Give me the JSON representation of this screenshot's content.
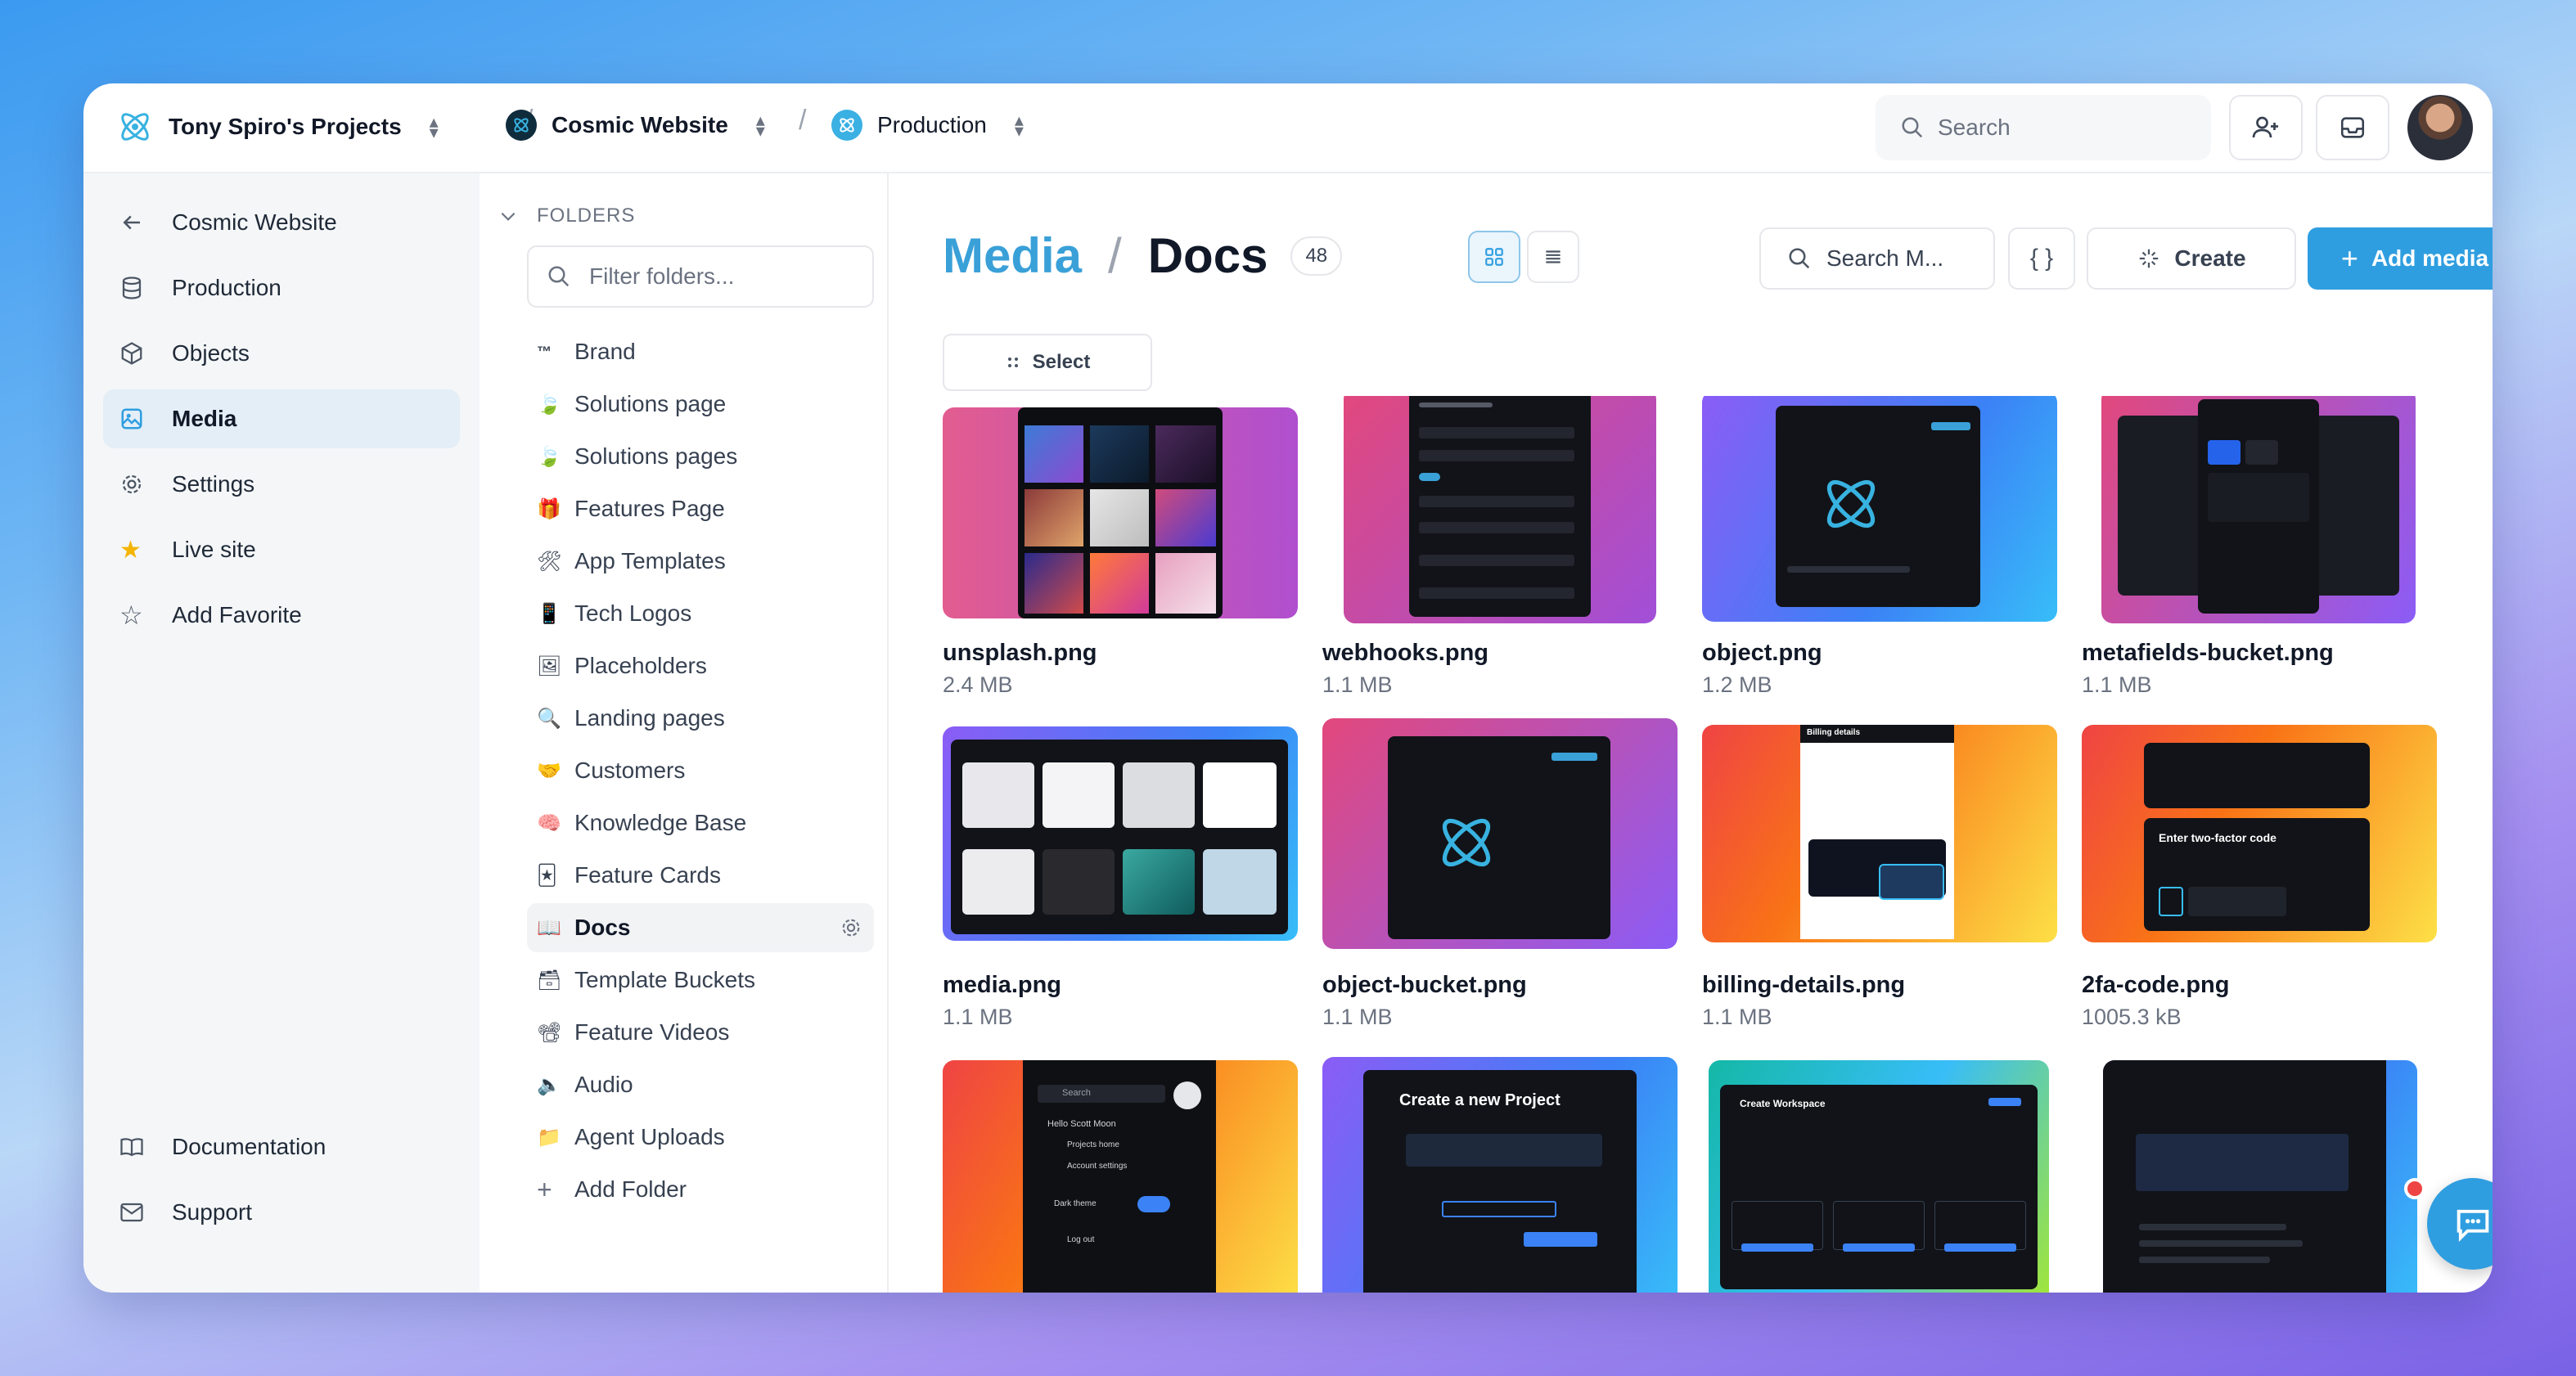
{
  "topbar": {
    "workspace": "Tony Spiro's Projects",
    "project": "Cosmic Website",
    "bucket": "Production",
    "search_placeholder": "Search"
  },
  "leftnav": {
    "items": [
      {
        "label": "Cosmic Website",
        "icon": "arrow-left-icon"
      },
      {
        "label": "Production",
        "icon": "database-icon"
      },
      {
        "label": "Objects",
        "icon": "cube-icon"
      },
      {
        "label": "Media",
        "icon": "image-icon"
      },
      {
        "label": "Settings",
        "icon": "gear-icon"
      },
      {
        "label": "Live site",
        "icon": "star-filled-icon"
      },
      {
        "label": "Add Favorite",
        "icon": "star-outline-icon"
      }
    ],
    "footer": [
      {
        "label": "Documentation",
        "icon": "book-icon"
      },
      {
        "label": "Support",
        "icon": "mail-icon"
      }
    ]
  },
  "folders": {
    "heading": "FOLDERS",
    "filter_placeholder": "Filter folders...",
    "items": [
      {
        "emoji": "™",
        "label": "Brand"
      },
      {
        "emoji": "🍃",
        "label": "Solutions page"
      },
      {
        "emoji": "🍃",
        "label": "Solutions pages"
      },
      {
        "emoji": "🎁",
        "label": "Features Page"
      },
      {
        "emoji": "🛠",
        "label": "App Templates"
      },
      {
        "emoji": "📱",
        "label": "Tech Logos"
      },
      {
        "emoji": "🖼",
        "label": "Placeholders"
      },
      {
        "emoji": "🔍",
        "label": "Landing pages"
      },
      {
        "emoji": "🤝",
        "label": "Customers"
      },
      {
        "emoji": "🧠",
        "label": "Knowledge Base"
      },
      {
        "emoji": "🃏",
        "label": "Feature Cards"
      },
      {
        "emoji": "📖",
        "label": "Docs"
      },
      {
        "emoji": "🗃",
        "label": "Template Buckets"
      },
      {
        "emoji": "📽",
        "label": "Feature Videos"
      },
      {
        "emoji": "🔈",
        "label": "Audio"
      },
      {
        "emoji": "📁",
        "label": "Agent Uploads"
      }
    ],
    "add_label": "Add Folder"
  },
  "main": {
    "title_section": "Media",
    "title_folder": "Docs",
    "count": "48",
    "search_placeholder": "Search M...",
    "json_label": "{ }",
    "create_label": "Create",
    "add_media_label": "Add media",
    "select_label": "Select"
  },
  "media": [
    {
      "name": "unsplash.png",
      "size": "2.4 MB"
    },
    {
      "name": "webhooks.png",
      "size": "1.1 MB"
    },
    {
      "name": "object.png",
      "size": "1.2 MB"
    },
    {
      "name": "metafields-bucket.png",
      "size": "1.1 MB"
    },
    {
      "name": "media.png",
      "size": "1.1 MB"
    },
    {
      "name": "object-bucket.png",
      "size": "1.1 MB"
    },
    {
      "name": "billing-details.png",
      "size": "1.1 MB"
    },
    {
      "name": "2fa-code.png",
      "size": "1005.3 kB"
    },
    {
      "name": "",
      "size": ""
    },
    {
      "name": "",
      "size": ""
    },
    {
      "name": "",
      "size": ""
    },
    {
      "name": "",
      "size": ""
    }
  ],
  "thumb_texts": {
    "t10": "Create a new Project",
    "t9_search": "Search",
    "t9_hello": "Hello Scott Moon",
    "t9_home": "Projects home",
    "t9_account": "Account settings",
    "t9_dark": "Dark theme",
    "t9_logout": "Log out",
    "t11": "Create Workspace",
    "t8": "Enter two-factor code",
    "t7": "Billing details"
  },
  "colors": {
    "accent": "#2f9ee0",
    "media_title": "#3aa0d8",
    "nav_active": "#e3eef7"
  }
}
